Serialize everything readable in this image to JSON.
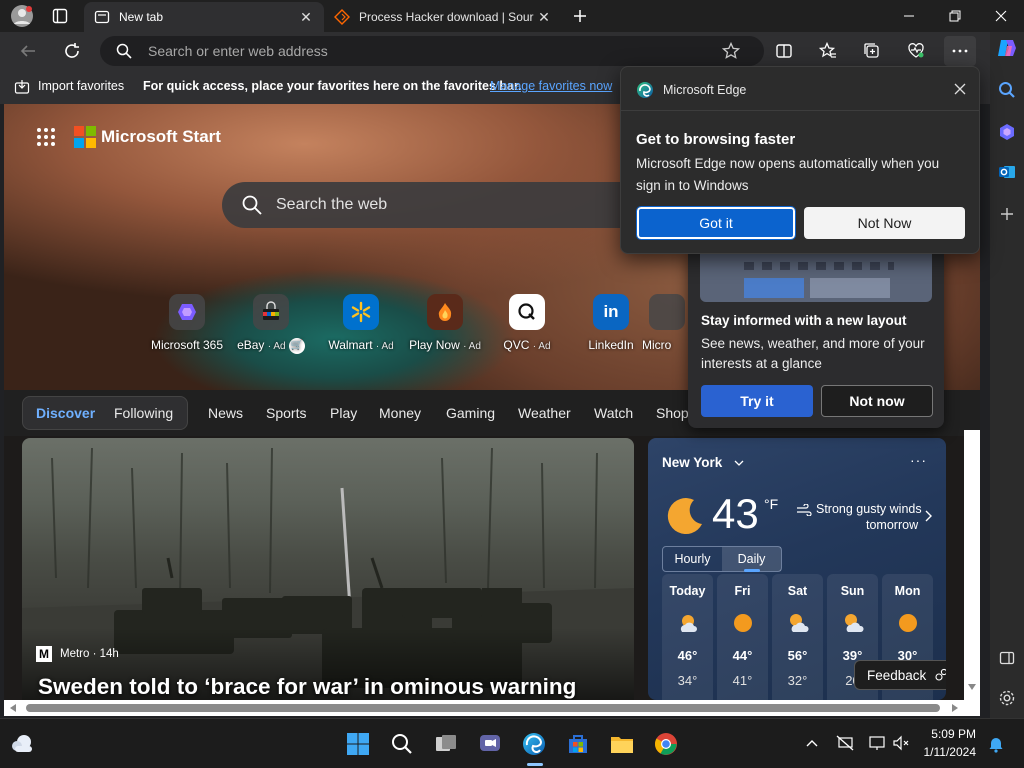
{
  "browser": {
    "tabs": [
      {
        "title": "New tab",
        "active": true
      },
      {
        "title": "Process Hacker download | Sour",
        "active": false
      }
    ],
    "address_placeholder": "Search or enter web address"
  },
  "favorites_bar": {
    "import_label": "Import favorites",
    "hint": "For quick access, place your favorites here on the favorites bar.",
    "manage_link": "Manage favorites now"
  },
  "msstart": {
    "brand": "Microsoft Start",
    "search_placeholder": "Search the web",
    "quick_links": [
      {
        "label": "Microsoft 365",
        "ad": ""
      },
      {
        "label": "eBay",
        "ad": "· Ad"
      },
      {
        "label": "Walmart",
        "ad": "· Ad"
      },
      {
        "label": "Play Now",
        "ad": "· Ad"
      },
      {
        "label": "QVC",
        "ad": "· Ad"
      },
      {
        "label": "LinkedIn",
        "ad": ""
      },
      {
        "label": "Micro",
        "ad": ""
      }
    ],
    "segment": {
      "discover": "Discover",
      "following": "Following"
    },
    "categories": [
      "News",
      "Sports",
      "Play",
      "Money",
      "Gaming",
      "Weather",
      "Watch",
      "Shop"
    ]
  },
  "news_card": {
    "source": "Metro · 14h",
    "headline": "Sweden told to ‘brace for war’ in ominous warning"
  },
  "weather": {
    "location": "New York",
    "temp": "43",
    "unit": "°F",
    "alert_line1": "Strong gusty winds",
    "alert_line2": "tomorrow",
    "toggle": {
      "hourly": "Hourly",
      "daily": "Daily"
    },
    "days": [
      {
        "day": "Today",
        "hi": "46°",
        "lo": "34°",
        "icon": "partly-sunny"
      },
      {
        "day": "Fri",
        "hi": "44°",
        "lo": "41°",
        "icon": "sunny"
      },
      {
        "day": "Sat",
        "hi": "56°",
        "lo": "32°",
        "icon": "partly-cloudy"
      },
      {
        "day": "Sun",
        "hi": "39°",
        "lo": "20",
        "icon": "partly-cloudy"
      },
      {
        "day": "Mon",
        "hi": "30°",
        "lo": "",
        "icon": "sunny"
      }
    ],
    "feedback": "Feedback"
  },
  "promo": {
    "title": "Stay informed with a new layout",
    "body": "See news, weather, and more of your interests at a glance",
    "try_it": "Try it",
    "not_now": "Not now"
  },
  "edge_popup": {
    "app": "Microsoft Edge",
    "title": "Get to browsing faster",
    "body": "Microsoft Edge now opens automatically when you sign in to Windows",
    "got_it": "Got it",
    "not_now": "Not Now"
  },
  "taskbar": {
    "time": "5:09 PM",
    "date": "1/11/2024"
  },
  "colors": {
    "accent_blue": "#1f6fd1",
    "link_blue": "#5aa5ff",
    "titlebar": "#202020",
    "toolbar": "#2f2f31"
  }
}
